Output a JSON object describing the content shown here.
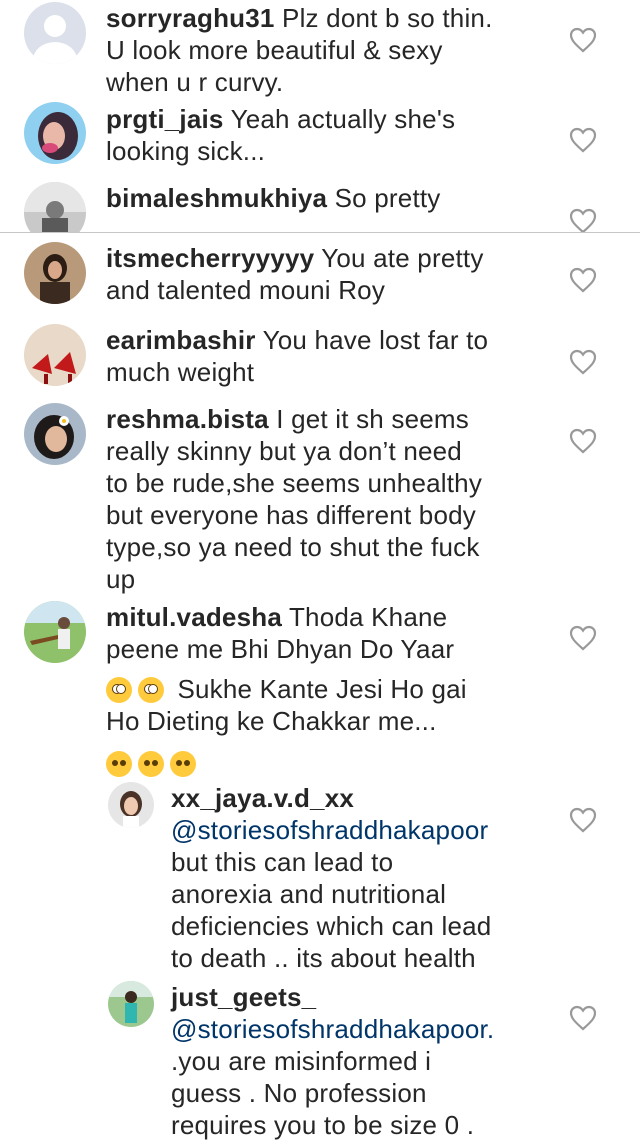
{
  "comments": [
    {
      "username": "sorryraghu31",
      "lines": [
        "Plz dont b so thin.",
        "U look more beautiful & sexy",
        "when u r curvy."
      ]
    },
    {
      "username": "prgti_jais",
      "lines": [
        "Yeah actually she's",
        "looking sick..."
      ]
    },
    {
      "username": "bimaleshmukhiya",
      "lines": [
        "So pretty"
      ]
    },
    {
      "username": "itsmecherryyyyy",
      "lines": [
        "You ate pretty",
        "and talented mouni Roy"
      ]
    },
    {
      "username": "earimbashir",
      "lines": [
        "You have lost far to",
        "much weight"
      ]
    },
    {
      "username": "reshma.bista",
      "lines": [
        "I get it sh seems",
        "really skinny but ya don’t need",
        "to be rude,she seems unhealthy",
        "but everyone has different body",
        "type,so ya need to shut the fuck",
        "up"
      ]
    },
    {
      "username": "mitul.vadesha",
      "lines": [
        "Thoda Khane",
        "peene me Bhi Dhyan Do Yaar",
        "Sukhe Kante Jesi Ho gai",
        "Ho Dieting ke Chakkar me..."
      ]
    }
  ],
  "replies": [
    {
      "username": "xx_jaya.v.d_xx",
      "mention": "@storiesofshraddhakapoor",
      "lines": [
        "but this can lead to",
        "anorexia and nutritional",
        "deficiencies which can lead",
        "to death .. its about health"
      ]
    },
    {
      "username": "just_geets_",
      "mention": "@storiesofshraddhakapoor.",
      "lines": [
        ".you are misinformed i",
        "guess . No profession",
        "requires you to be size 0 ."
      ]
    }
  ],
  "icons": {
    "like": "heart-outline-icon",
    "emoji_rolling": "face-with-rolling-eyes",
    "emoji_confounded": "confounded-face",
    "emoji_smirk": "smirking-face"
  },
  "colors": {
    "text": "#262626",
    "mention": "#003569",
    "heart_stroke": "#999999",
    "divider": "#c7c7c7"
  }
}
